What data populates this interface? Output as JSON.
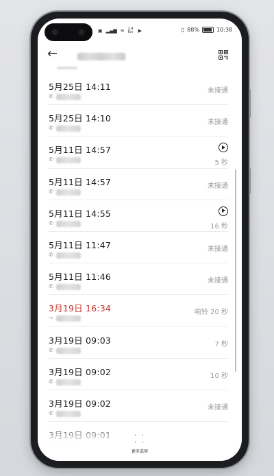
{
  "status_bar": {
    "left_icons": [
      "nfc-icon",
      "signal-icon",
      "wifi-icon",
      "speed-icon",
      "video-icon"
    ],
    "network_speed": "2.4 K/s",
    "battery": "88%",
    "time": "10:38"
  },
  "header": {
    "back_icon": "back-arrow-icon",
    "qr_icon": "qr-code-icon"
  },
  "calls": [
    {
      "time": "5月25日 14:11",
      "status": "未接通",
      "type": "outgoing",
      "missed": false,
      "recording": false
    },
    {
      "time": "5月25日 14:10",
      "status": "未接通",
      "type": "outgoing",
      "missed": false,
      "recording": false
    },
    {
      "time": "5月11日 14:57",
      "status": "5 秒",
      "type": "outgoing",
      "missed": false,
      "recording": true
    },
    {
      "time": "5月11日 14:57",
      "status": "未接通",
      "type": "outgoing",
      "missed": false,
      "recording": false
    },
    {
      "time": "5月11日 14:55",
      "status": "16 秒",
      "type": "outgoing",
      "missed": false,
      "recording": true
    },
    {
      "time": "5月11日 11:47",
      "status": "未接通",
      "type": "outgoing",
      "missed": false,
      "recording": false
    },
    {
      "time": "5月11日 11:46",
      "status": "未接通",
      "type": "outgoing",
      "missed": false,
      "recording": false
    },
    {
      "time": "3月19日 16:34",
      "status": "响铃 20 秒",
      "type": "missed",
      "missed": true,
      "recording": false
    },
    {
      "time": "3月19日 09:03",
      "status": "7 秒",
      "type": "outgoing",
      "missed": false,
      "recording": false
    },
    {
      "time": "3月19日 09:02",
      "status": "10 秒",
      "type": "outgoing",
      "missed": false,
      "recording": false
    },
    {
      "time": "3月19日 09:02",
      "status": "未接通",
      "type": "outgoing",
      "missed": false,
      "recording": false
    },
    {
      "time": "3月19日 09:01",
      "status": "",
      "type": "outgoing",
      "missed": false,
      "recording": false
    }
  ],
  "more_button": {
    "label": "更多选项"
  },
  "colors": {
    "missed": "#c8332b",
    "text": "#1a1a1a",
    "secondary": "#9a9a9a"
  }
}
